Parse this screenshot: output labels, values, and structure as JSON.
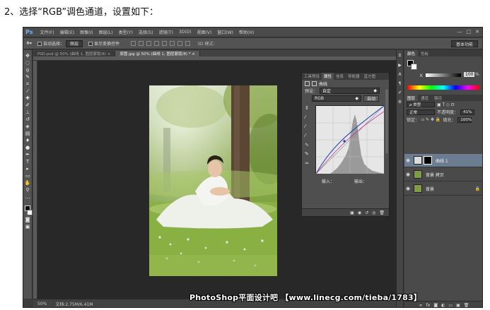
{
  "caption": "2、选择“RGB”调色通道，设置如下：",
  "app": {
    "logo": "Ps",
    "menus": [
      "文件(F)",
      "编辑(E)",
      "图像(I)",
      "图层(L)",
      "类型(Y)",
      "选择(S)",
      "滤镜(T)",
      "3D(D)",
      "视图(V)",
      "窗口(W)",
      "帮助(H)"
    ],
    "window_controls": [
      "—",
      "□",
      "✕"
    ]
  },
  "options_bar": {
    "auto_select_label": "自动选择：",
    "auto_select_value": "图层",
    "show_transform_label": "显示变换控件",
    "mode_3d_label": "3D 模式：",
    "workspace": "基本功能"
  },
  "tabs": [
    {
      "label": "PSD.psd @ 50% (曲线 1, 图层蒙版/8) ×",
      "active": false
    },
    {
      "label": "原图.jpg @ 50% (曲线 1, 图层蒙版/8) * ×",
      "active": true
    }
  ],
  "status": {
    "zoom": "50%",
    "doc": "文档:2.75M/6.41M"
  },
  "watermark": "PhotoShop平面设计吧 【www.linecg.com/tieba/1783】",
  "properties": {
    "tabs": [
      "工具预设",
      "属性",
      "信息",
      "导航器",
      "直方图"
    ],
    "active_tab": 1,
    "title": "曲线",
    "preset_label": "预设：",
    "preset_value": "自定",
    "channel_value": "RGB",
    "auto_label": "自动",
    "input_label": "输入：",
    "output_label": "输出："
  },
  "color_panel": {
    "tabs": [
      "颜色",
      "色板"
    ],
    "k_label": "K",
    "k_value": "100",
    "k_unit": "%"
  },
  "layers_panel": {
    "tabs": [
      "图层",
      "通道",
      "路径"
    ],
    "kind_filter": "ρ 类型",
    "blend_mode": "正常",
    "opacity_label": "不透明度：",
    "opacity_value": "41%",
    "lock_label": "锁定：",
    "fill_label": "填充：",
    "fill_value": "100%",
    "layers": [
      {
        "name": "曲线 1",
        "selected": true
      },
      {
        "name": "背景 拷贝",
        "selected": false
      },
      {
        "name": "背景",
        "selected": false
      }
    ]
  },
  "colors": {
    "accent_blue": "#6fb3ff",
    "selected_layer": "#6c7d92"
  }
}
